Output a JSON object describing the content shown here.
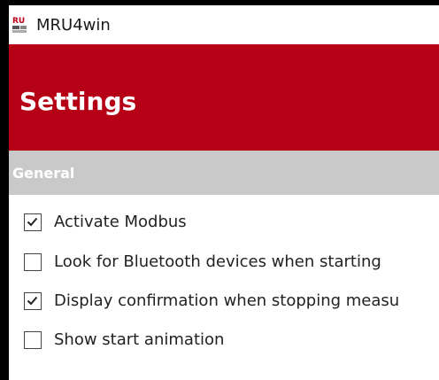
{
  "window": {
    "title": "MRU4win",
    "icon": "mru-app-icon"
  },
  "header": {
    "title": "Settings"
  },
  "section": {
    "label": "General"
  },
  "options": [
    {
      "label": "Activate Modbus",
      "checked": true
    },
    {
      "label": "Look for Bluetooth devices when starting",
      "checked": false
    },
    {
      "label": "Display confirmation when stopping measu",
      "checked": true
    },
    {
      "label": "Show start animation",
      "checked": false
    }
  ],
  "colors": {
    "accent": "#b50016",
    "section_bar": "#c9c9c9",
    "frame": "#000000"
  }
}
